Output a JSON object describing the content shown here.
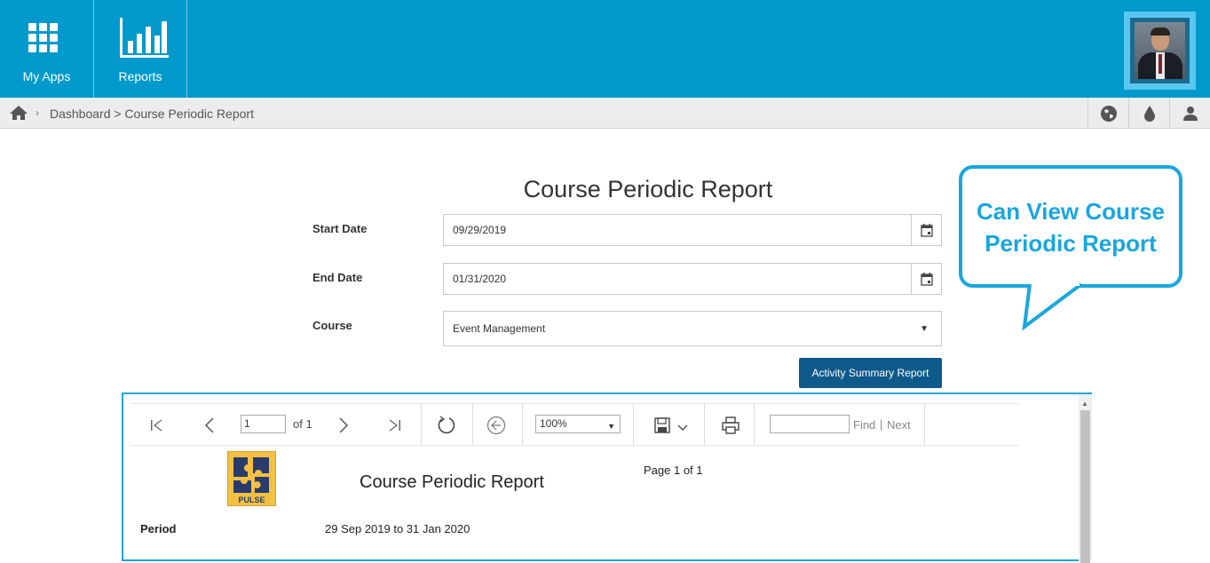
{
  "topbar": {
    "apps": [
      {
        "label": "My Apps",
        "icon": "grid-icon"
      },
      {
        "label": "Reports",
        "icon": "bar-chart-icon"
      }
    ],
    "colors": {
      "bar": "#0099cc",
      "avatar_frame": "#58c8f0"
    }
  },
  "breadcrumb": {
    "text": "Dashboard > Course Periodic Report",
    "icons": [
      "home-icon",
      "globe-icon",
      "drop-icon",
      "user-icon"
    ]
  },
  "form": {
    "title": "Course Periodic Report",
    "start_date": {
      "label": "Start Date",
      "value": "09/29/2019"
    },
    "end_date": {
      "label": "End Date",
      "value": "01/31/2020"
    },
    "course": {
      "label": "Course",
      "value": "Event Management"
    },
    "submit_label": "Activity Summary Report"
  },
  "callout": {
    "line1": "Can View Course",
    "line2": "Periodic Report",
    "color": "#19a6de"
  },
  "viewer": {
    "toolbar": {
      "page_value": "1",
      "page_of": "of 1",
      "zoom": "100%",
      "find_label": "Find",
      "separator": "|",
      "next_label": "Next"
    },
    "report": {
      "logo_text": "PULSE",
      "title": "Course Periodic Report",
      "page_info": "Page 1 of 1",
      "period_label": "Period",
      "period_value": "29 Sep 2019 to 31 Jan 2020"
    }
  }
}
